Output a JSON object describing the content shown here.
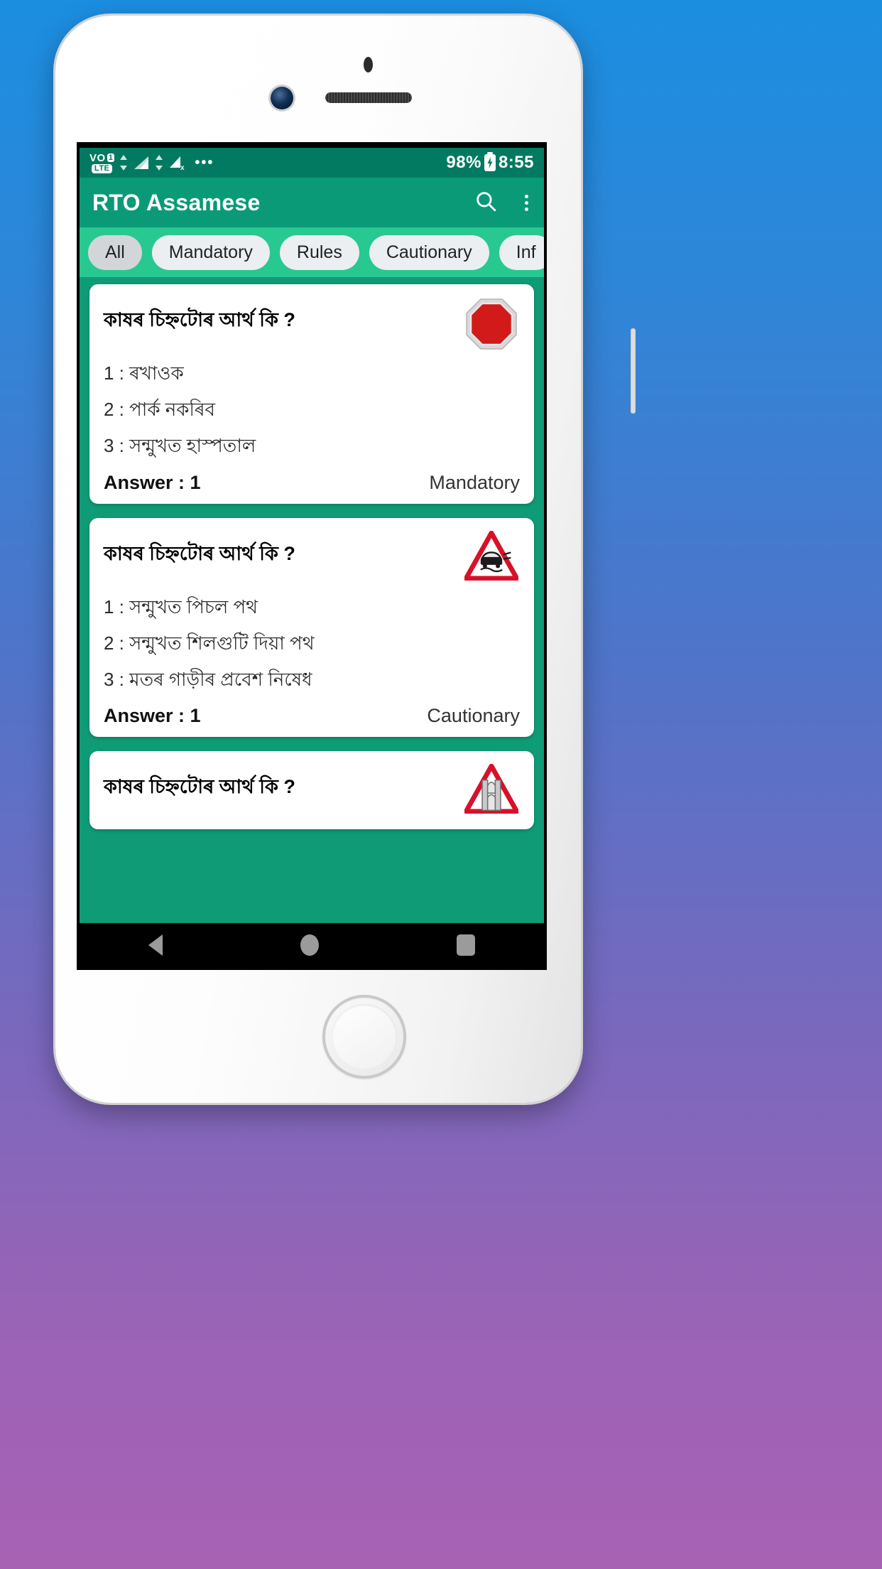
{
  "device": {
    "frame": "white-phone-mockup",
    "background_gradient": [
      "#1b8ee0",
      "#a862b4"
    ]
  },
  "status_bar": {
    "volte_label_top": "VO",
    "volte_badge": "1",
    "volte_label_bottom": "LTE",
    "overflow_dots": "•••",
    "battery_percent": "98%",
    "time": "8:55",
    "bg_color": "#027a62"
  },
  "app_bar": {
    "title": "RTO Assamese",
    "search_icon": "search-icon",
    "overflow_icon": "more-vertical-icon",
    "bg_color": "#0a9a77"
  },
  "filters": {
    "bg_color": "#28c891",
    "chips": [
      {
        "label": "All",
        "selected": true
      },
      {
        "label": "Mandatory",
        "selected": false
      },
      {
        "label": "Rules",
        "selected": false
      },
      {
        "label": "Cautionary",
        "selected": false
      },
      {
        "label": "Inf",
        "selected": false
      }
    ]
  },
  "cards": [
    {
      "question": "কাষৰ চিহ্নটোৰ আৰ্থ কি ?",
      "sign": "stop-sign-red-octagon",
      "options": [
        "1 : ৰখাওক",
        "2 : পাৰ্ক নকৰিব",
        "3 : সন্মুখত হাস্পতাল"
      ],
      "answer_label": "Answer : 1",
      "category": "Mandatory"
    },
    {
      "question": "কাষৰ চিহ্নটোৰ আৰ্থ কি ?",
      "sign": "slippery-road-warning-triangle",
      "options": [
        "1 : সন্মুখত পিচল পথ",
        "2 : সন্মুখত শিলগুটি দিয়া পথ",
        "3 : মতৰ গাড়ীৰ প্ৰবেশ নিষেধ"
      ],
      "answer_label": "Answer : 1",
      "category": "Cautionary"
    },
    {
      "question": "কাষৰ চিহ্নটোৰ আৰ্থ কি ?",
      "sign": "narrow-bridge-warning-triangle",
      "options": [],
      "answer_label": "",
      "category": ""
    }
  ],
  "nav_bar": {
    "back_icon": "back-triangle-icon",
    "home_icon": "home-circle-icon",
    "recents_icon": "recents-square-icon"
  }
}
